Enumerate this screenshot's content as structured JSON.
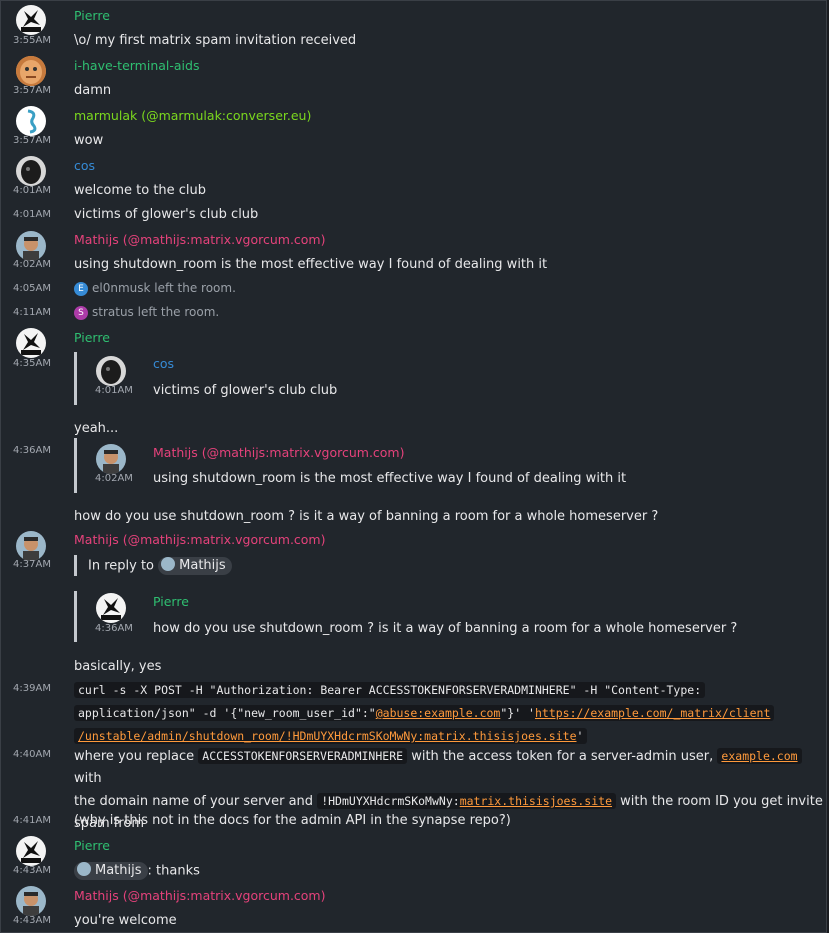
{
  "colors": {
    "background": "#21262c",
    "pierre": "#2fbf71",
    "terminal": "#2fbf71",
    "marmulak": "#7bd81e",
    "cos": "#368bd6",
    "mathijs": "#e5427b",
    "link": "#ff9a3c"
  },
  "users": {
    "pierre": "Pierre",
    "terminal": "i-have-terminal-aids",
    "marmulak": "marmulak (@marmulak:converser.eu)",
    "cos": "cos",
    "mathijs": "Mathijs (@mathijs:matrix.vgorcum.com)",
    "mathijs_short": "Mathijs"
  },
  "events": {
    "e1": {
      "time": "3:55AM",
      "text": "\\o/ my first matrix spam invitation received"
    },
    "e2": {
      "time": "3:57AM",
      "text": "damn"
    },
    "e3": {
      "time": "3:57AM",
      "text": "wow"
    },
    "e4": {
      "time": "4:01AM",
      "text": "welcome to the club"
    },
    "e5": {
      "time": "4:01AM",
      "text": "victims of glower's club club"
    },
    "e6": {
      "time": "4:02AM",
      "text": "using shutdown_room is the most effective way I found of dealing with it"
    },
    "e7": {
      "time": "4:05AM",
      "avatar_letter": "E",
      "text": "el0nmusk left the room."
    },
    "e8": {
      "time": "4:11AM",
      "avatar_letter": "S",
      "text": "stratus left the room."
    },
    "e9": {
      "time": "4:35AM",
      "quote_time": "4:01AM",
      "quote_text": "victims of glower's club club",
      "text": "yeah..."
    },
    "e10": {
      "time": "4:36AM",
      "quote_time": "4:02AM",
      "quote_text": "using shutdown_room is the most effective way I found of dealing with it",
      "text": "how do you use shutdown_room ? is it a way of banning a room for a whole homeserver ?"
    },
    "e11": {
      "time": "4:37AM",
      "in_reply_to": "In reply to",
      "quote_time": "4:36AM",
      "quote_text": "how do you use shutdown_room ? is it a way of banning a room for a whole homeserver ?",
      "text": "basically, yes"
    },
    "e12": {
      "time": "4:39AM",
      "code_a": "curl -s -X POST -H \"Authorization: Bearer ACCESSTOKENFORSERVERADMINHERE\" -H \"Content-Type:",
      "code_b": "application/json\" -d '{\"new_room_user_id\":\"",
      "code_b_link": "@abuse:example.com",
      "code_b_end": "\"}' '",
      "code_b_link2": "https://example.com/_matrix/client",
      "code_c_link": "/unstable/admin/shutdown_room/!HDmUYXHdcrmSKoMwNy:matrix.thisisjoes.site",
      "code_c_end": "'"
    },
    "e13": {
      "time": "4:40AM",
      "t1": "where you replace",
      "c1": "ACCESSTOKENFORSERVERADMINHERE",
      "t2": "with the access token for a server-admin user,",
      "c2_link": "example.com",
      "t3": "with",
      "t4": "the domain name of your server and",
      "c3": "!HDmUYXHdcrmSKoMwNy:",
      "c3_link": "matrix.thisisjoes.site",
      "t5": "with the room ID you get invite",
      "t6": "spam from"
    },
    "e14": {
      "time": "4:41AM",
      "text": "(why is this not in the docs for the admin API in the synapse repo?)"
    },
    "e15": {
      "time": "4:43AM",
      "text": ": thanks"
    },
    "e16": {
      "time": "4:43AM",
      "text": "you're welcome"
    }
  }
}
